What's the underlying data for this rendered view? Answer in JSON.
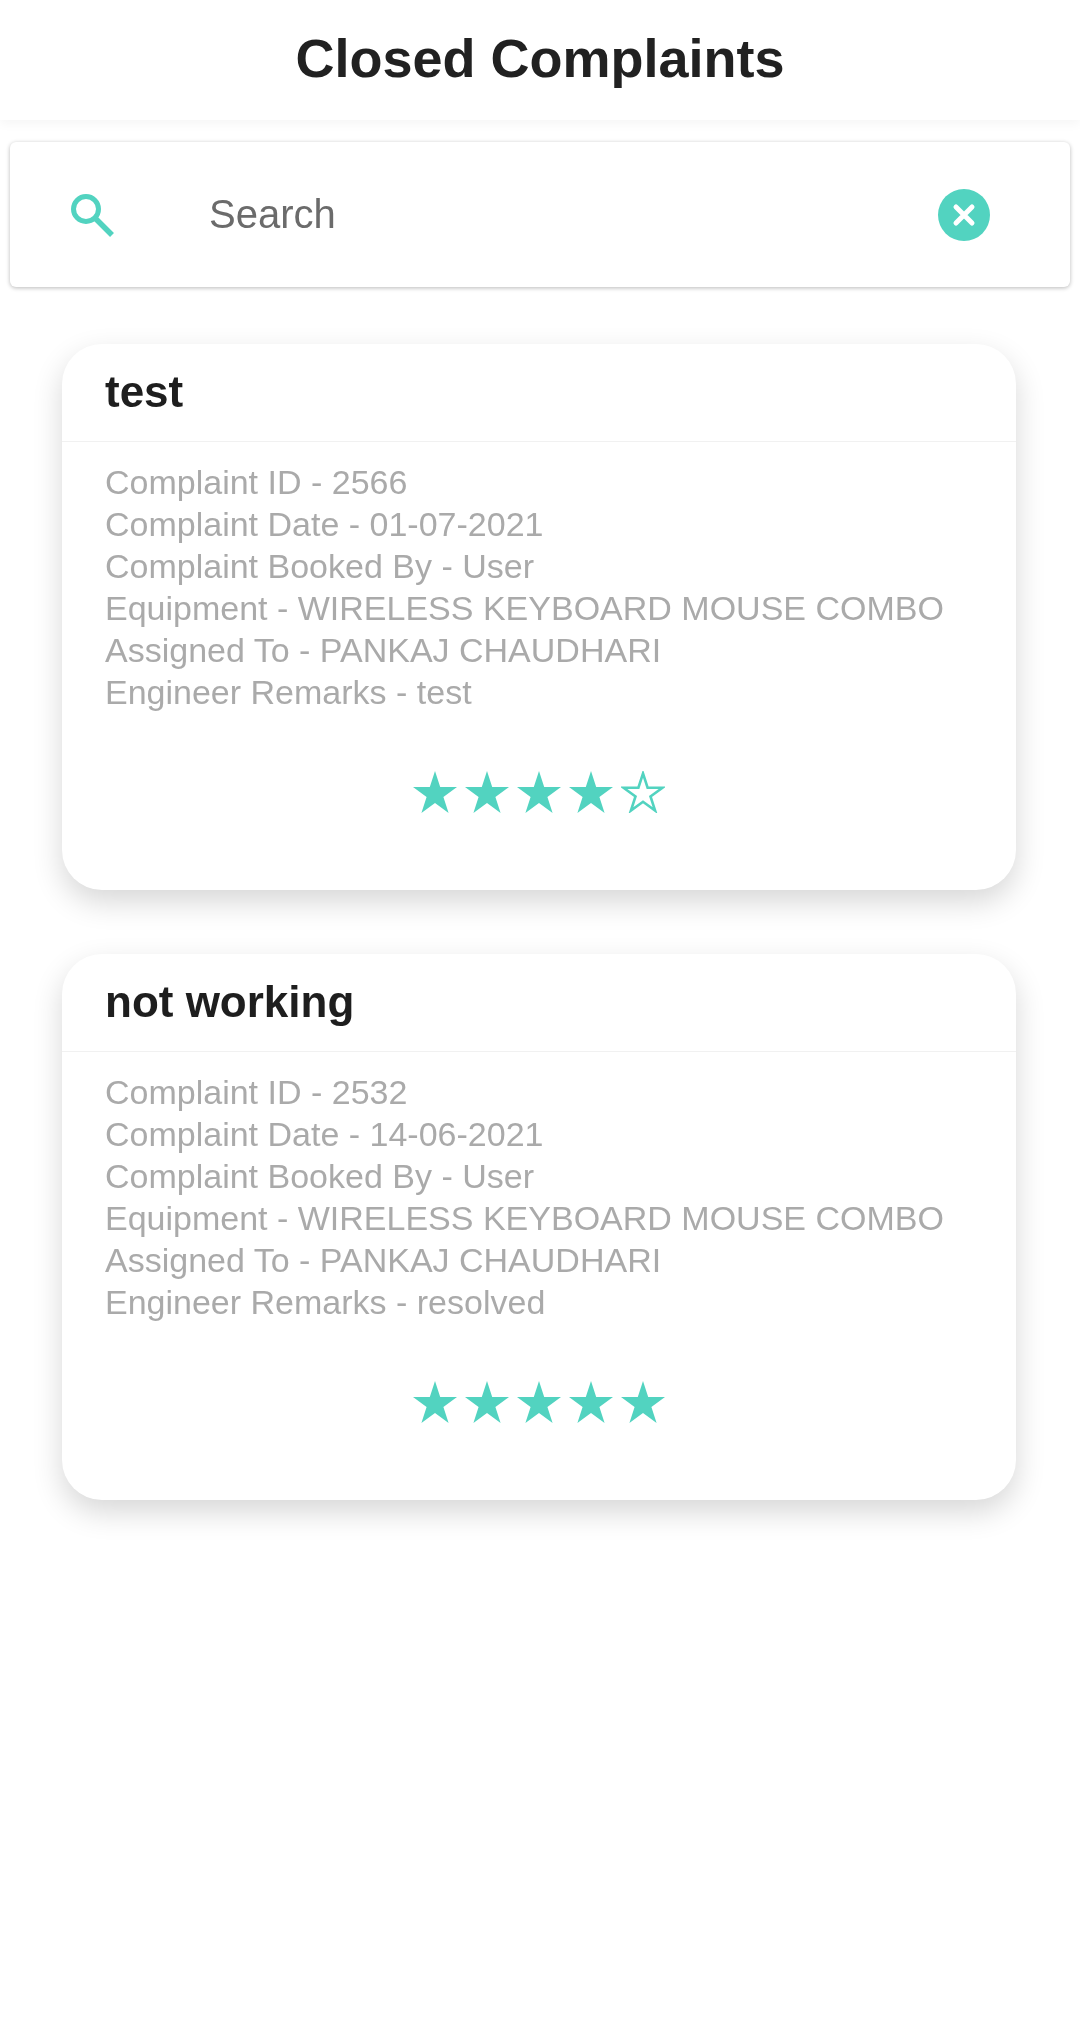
{
  "header": {
    "title": "Closed Complaints"
  },
  "search": {
    "placeholder": "Search"
  },
  "complaints": [
    {
      "title": "test",
      "details": [
        "Complaint ID - 2566",
        "Complaint Date - 01-07-2021",
        "Complaint Booked By - User",
        "Equipment - WIRELESS KEYBOARD MOUSE COMBO",
        "Assigned To - PANKAJ CHAUDHARI",
        "Engineer Remarks - test"
      ],
      "stars": 4
    },
    {
      "title": "not working",
      "details": [
        "Complaint ID - 2532",
        "Complaint Date - 14-06-2021",
        "Complaint Booked By - User",
        "Equipment - WIRELESS KEYBOARD MOUSE COMBO",
        "Assigned To - PANKAJ CHAUDHARI",
        "Engineer Remarks - resolved"
      ],
      "stars": 5
    }
  ]
}
